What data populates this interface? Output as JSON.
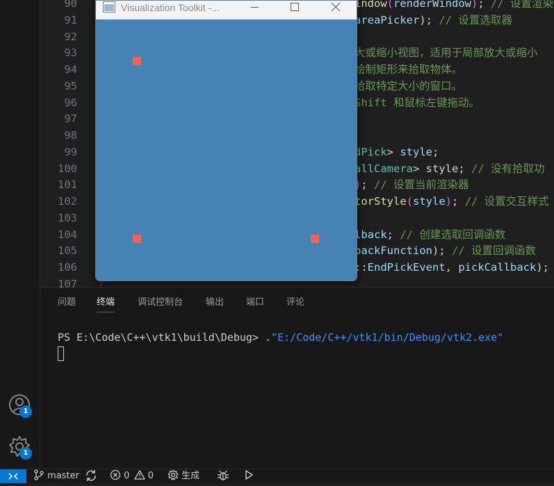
{
  "editor": {
    "lines": [
      {
        "num": "90",
        "tokens": [
          {
            "t": "indow",
            "c": "f"
          },
          {
            "t": "(",
            "c": "b"
          },
          {
            "t": "renderWindow",
            "c": "v"
          },
          {
            "t": ")",
            "c": "b"
          },
          {
            "t": "; ",
            "c": "p"
          },
          {
            "t": "// 设置渲染",
            "c": "c"
          }
        ]
      },
      {
        "num": "91",
        "tokens": [
          {
            "t": "areaPicker",
            "c": "v"
          },
          {
            "t": "); ",
            "c": "p"
          },
          {
            "t": "// 设置选取器",
            "c": "c"
          }
        ]
      },
      {
        "num": "92",
        "tokens": []
      },
      {
        "num": "93",
        "tokens": [
          {
            "t": "大或缩小视图，适用于局部放大或缩小",
            "c": "c"
          }
        ]
      },
      {
        "num": "94",
        "tokens": [
          {
            "t": "绘制矩形来拾取物体。",
            "c": "c"
          }
        ]
      },
      {
        "num": "95",
        "tokens": [
          {
            "t": "拾取特定大小的窗口。",
            "c": "c"
          }
        ]
      },
      {
        "num": "96",
        "tokens": [
          {
            "t": "Shift 和鼠标左键拖动。",
            "c": "c"
          }
        ]
      },
      {
        "num": "97",
        "tokens": []
      },
      {
        "num": "98",
        "tokens": []
      },
      {
        "num": "99",
        "tokens": [
          {
            "t": "dPick",
            "c": "t"
          },
          {
            "t": "> ",
            "c": "p"
          },
          {
            "t": "style",
            "c": "v"
          },
          {
            "t": ";",
            "c": "p"
          }
        ]
      },
      {
        "num": "100",
        "tokens": [
          {
            "t": "allCamera",
            "c": "t"
          },
          {
            "t": "> style; ",
            "c": "p"
          },
          {
            "t": "// 没有拾取功",
            "c": "c"
          }
        ]
      },
      {
        "num": "101",
        "tokens": [
          {
            "t": ")",
            "c": "b"
          },
          {
            "t": "; ",
            "c": "p"
          },
          {
            "t": "// 设置当前渲染器",
            "c": "c"
          }
        ]
      },
      {
        "num": "102",
        "tokens": [
          {
            "t": "torStyle",
            "c": "f"
          },
          {
            "t": "(",
            "c": "b"
          },
          {
            "t": "style",
            "c": "v"
          },
          {
            "t": ")",
            "c": "b"
          },
          {
            "t": "; ",
            "c": "p"
          },
          {
            "t": "// 设置交互样式",
            "c": "c"
          }
        ]
      },
      {
        "num": "103",
        "tokens": []
      },
      {
        "num": "104",
        "tokens": [
          {
            "t": "lback",
            "c": "v"
          },
          {
            "t": "; ",
            "c": "p"
          },
          {
            "t": "// 创建选取回调函数",
            "c": "c"
          }
        ]
      },
      {
        "num": "105",
        "tokens": [
          {
            "t": "backFunction",
            "c": "v"
          },
          {
            "t": "); ",
            "c": "p"
          },
          {
            "t": "// 设置回调函数",
            "c": "c"
          }
        ]
      },
      {
        "num": "106",
        "tokens": [
          {
            "t": "::",
            "c": "p"
          },
          {
            "t": "EndPickEvent",
            "c": "v"
          },
          {
            "t": ", ",
            "c": "p"
          },
          {
            "t": "pickCallback",
            "c": "v"
          },
          {
            "t": ");",
            "c": "p"
          }
        ]
      },
      {
        "num": "107",
        "tokens": []
      }
    ]
  },
  "panel": {
    "tabs": [
      "问题",
      "终端",
      "调试控制台",
      "输出",
      "端口",
      "评论"
    ],
    "active_tab": "终端",
    "terminal": {
      "prompt": "PS E:\\Code\\C++\\vtk1\\build\\Debug> ",
      "command_prefix": ".",
      "command_path": "\"E:/Code/C++/vtk1/bin/Debug/vtk2.exe\""
    }
  },
  "activity": {
    "accounts_badge": "1",
    "settings_badge": "1"
  },
  "status": {
    "branch": "master",
    "errors": "0",
    "warnings": "0",
    "build_label": "生成"
  },
  "vtk_window": {
    "title": "Visualization Toolkit -...",
    "background_color": "#4682b4",
    "point_color": "#f76150"
  },
  "colors": {
    "accent": "#0078d4",
    "comment": "#6a9955",
    "variable": "#9cdcfe",
    "function": "#dcdcaa",
    "type": "#4ec9b0"
  }
}
